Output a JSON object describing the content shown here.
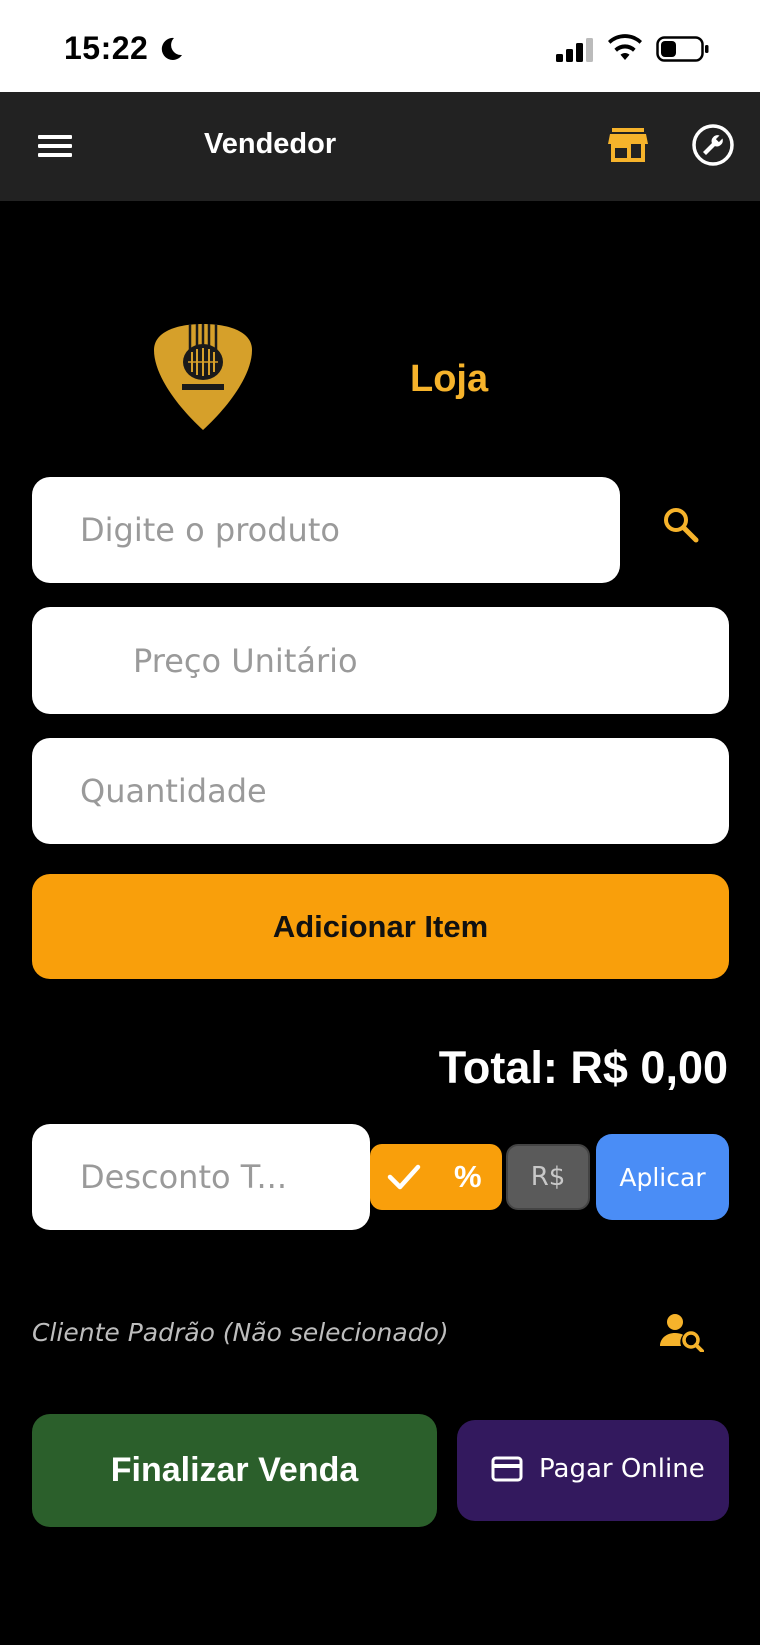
{
  "status_bar": {
    "time": "15:22"
  },
  "app_bar": {
    "title": "Vendedor",
    "icons": {
      "menu": "menu-icon",
      "store": "store-icon",
      "settings": "wrench-icon"
    }
  },
  "brand": {
    "name": "Loja",
    "logo": "guitar-pick-logo"
  },
  "form": {
    "product_placeholder": "Digite o produto",
    "price_placeholder": "Preço Unitário",
    "quantity_placeholder": "Quantidade",
    "add_button_label": "Adicionar Item"
  },
  "total": {
    "label": "Total: R$ 0,00"
  },
  "discount": {
    "placeholder": "Desconto T...",
    "percent_label": "%",
    "currency_label": "R$",
    "selected": "percent",
    "apply_label": "Aplicar"
  },
  "client": {
    "label": "Cliente Padrão (Não selecionado)"
  },
  "actions": {
    "finish_label": "Finalizar Venda",
    "pay_online_label": "Pagar Online"
  },
  "colors": {
    "accent": "#f99f0b",
    "brand_text": "#f6b32b",
    "apply": "#4a8df6",
    "finish": "#2b5f2b",
    "pay_online": "#33195e",
    "app_bar": "#222222"
  }
}
